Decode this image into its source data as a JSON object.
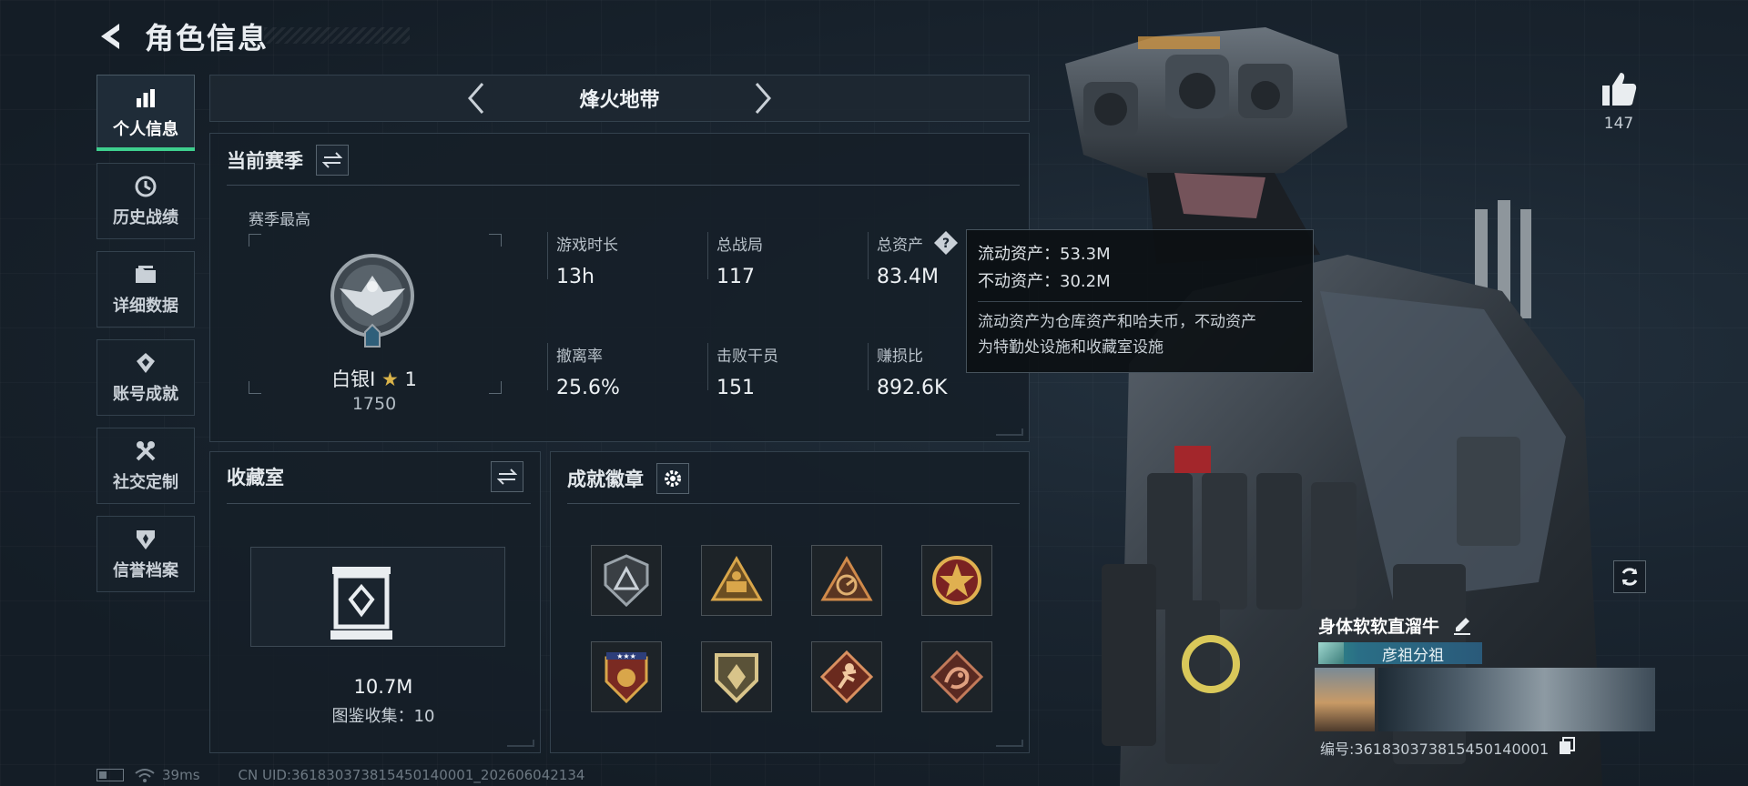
{
  "header": {
    "title": "角色信息"
  },
  "sidebar": {
    "items": [
      {
        "label": "个人信息",
        "icon": "bar-chart-icon",
        "active": true
      },
      {
        "label": "历史战绩",
        "icon": "history-clock-icon",
        "active": false
      },
      {
        "label": "详细数据",
        "icon": "folder-icon",
        "active": false
      },
      {
        "label": "账号成就",
        "icon": "achievement-icon",
        "active": false
      },
      {
        "label": "社交定制",
        "icon": "tools-icon",
        "active": false
      },
      {
        "label": "信誉档案",
        "icon": "shield-icon",
        "active": false
      }
    ]
  },
  "mode": {
    "title": "烽火地带"
  },
  "season": {
    "title": "当前赛季",
    "best_label": "赛季最高",
    "rank_name": "白银I",
    "rank_stars": "1",
    "rank_points": "1750",
    "stats": [
      {
        "label": "游戏时长",
        "value": "13h"
      },
      {
        "label": "总战局",
        "value": "117"
      },
      {
        "label": "总资产",
        "value": "83.4M"
      },
      {
        "label": "撤离率",
        "value": "25.6%"
      },
      {
        "label": "击败干员",
        "value": "151"
      },
      {
        "label": "赚损比",
        "value": "892.6K"
      }
    ]
  },
  "tooltip": {
    "liquid": "流动资产：53.3M",
    "fixed": "不动资产：30.2M",
    "desc_line1": "流动资产为仓库资产和哈夫币，不动资产",
    "desc_line2": "为特勤处设施和收藏室设施"
  },
  "collection": {
    "title": "收藏室",
    "value": "10.7M",
    "count": "图鉴收集：10"
  },
  "badges": {
    "title": "成就徽章",
    "items": [
      {
        "name": "badge-triangle-shield",
        "colors": [
          "#3a3f44",
          "#9aa3aa"
        ]
      },
      {
        "name": "badge-gold-triangle",
        "colors": [
          "#6b4e22",
          "#d9a64a"
        ]
      },
      {
        "name": "badge-radar-triangle",
        "colors": [
          "#5a3522",
          "#d08a4a"
        ]
      },
      {
        "name": "badge-star-emblem",
        "colors": [
          "#7a2222",
          "#e0b050"
        ]
      },
      {
        "name": "badge-stars-shield",
        "colors": [
          "#7a2a22",
          "#d9a64a"
        ]
      },
      {
        "name": "badge-gold-shield",
        "colors": [
          "#5a5238",
          "#d8c48a"
        ]
      },
      {
        "name": "badge-runner-diamond",
        "colors": [
          "#6a2a1e",
          "#d99060"
        ]
      },
      {
        "name": "badge-dragon-diamond",
        "colors": [
          "#5a2a22",
          "#c27a5a"
        ]
      }
    ]
  },
  "likes": {
    "count": "147"
  },
  "player": {
    "name": "身体软软直溜牛",
    "clan": "彦祖分祖",
    "id": "编号:361830373815450140001"
  },
  "status": {
    "ping": "39ms",
    "uid": "CN UID:361830373815450140001_202606042134"
  },
  "colors": {
    "accent": "#3ecf8e",
    "panel": "#161f28",
    "border": "#33414d"
  }
}
